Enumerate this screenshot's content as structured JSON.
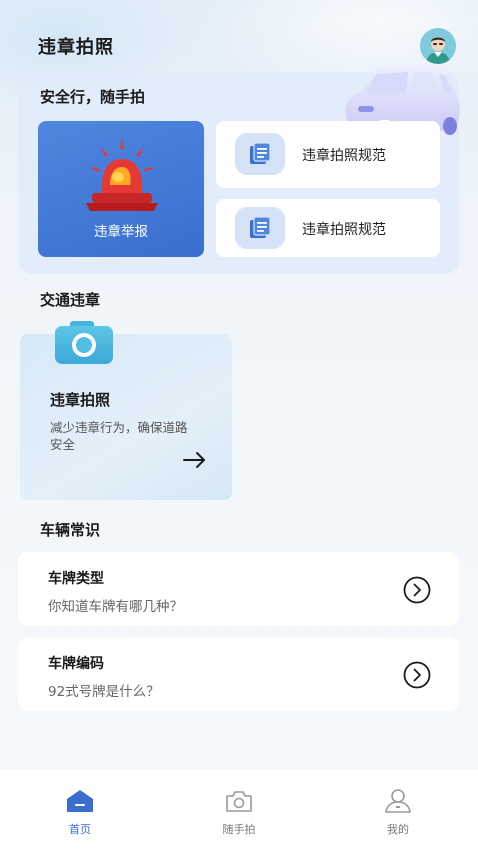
{
  "app": {
    "title": "违章拍照"
  },
  "hero": {
    "title": "安全行，随手拍",
    "report_label": "违章举报",
    "rules": [
      {
        "label": "违章拍照规范"
      },
      {
        "label": "违章拍照规范"
      }
    ]
  },
  "traffic": {
    "section_title": "交通违章",
    "card_title": "违章拍照",
    "card_desc": "减少违章行为，确保道路安全"
  },
  "vehicle": {
    "section_title": "车辆常识",
    "items": [
      {
        "title": "车牌类型",
        "subtitle": "你知道车牌有哪几种？"
      },
      {
        "title": "车牌编码",
        "subtitle": "92式号牌是什么？"
      }
    ]
  },
  "tabbar": {
    "tabs": [
      {
        "label": "首页",
        "icon": "home-icon",
        "active": true
      },
      {
        "label": "随手拍",
        "icon": "camera-icon",
        "active": false
      },
      {
        "label": "我的",
        "icon": "user-icon",
        "active": false
      }
    ]
  },
  "colors": {
    "accent": "#3a6fd1",
    "background": "#eef4fa",
    "card": "#ffffff",
    "hero_card": "#e1ebfb"
  }
}
